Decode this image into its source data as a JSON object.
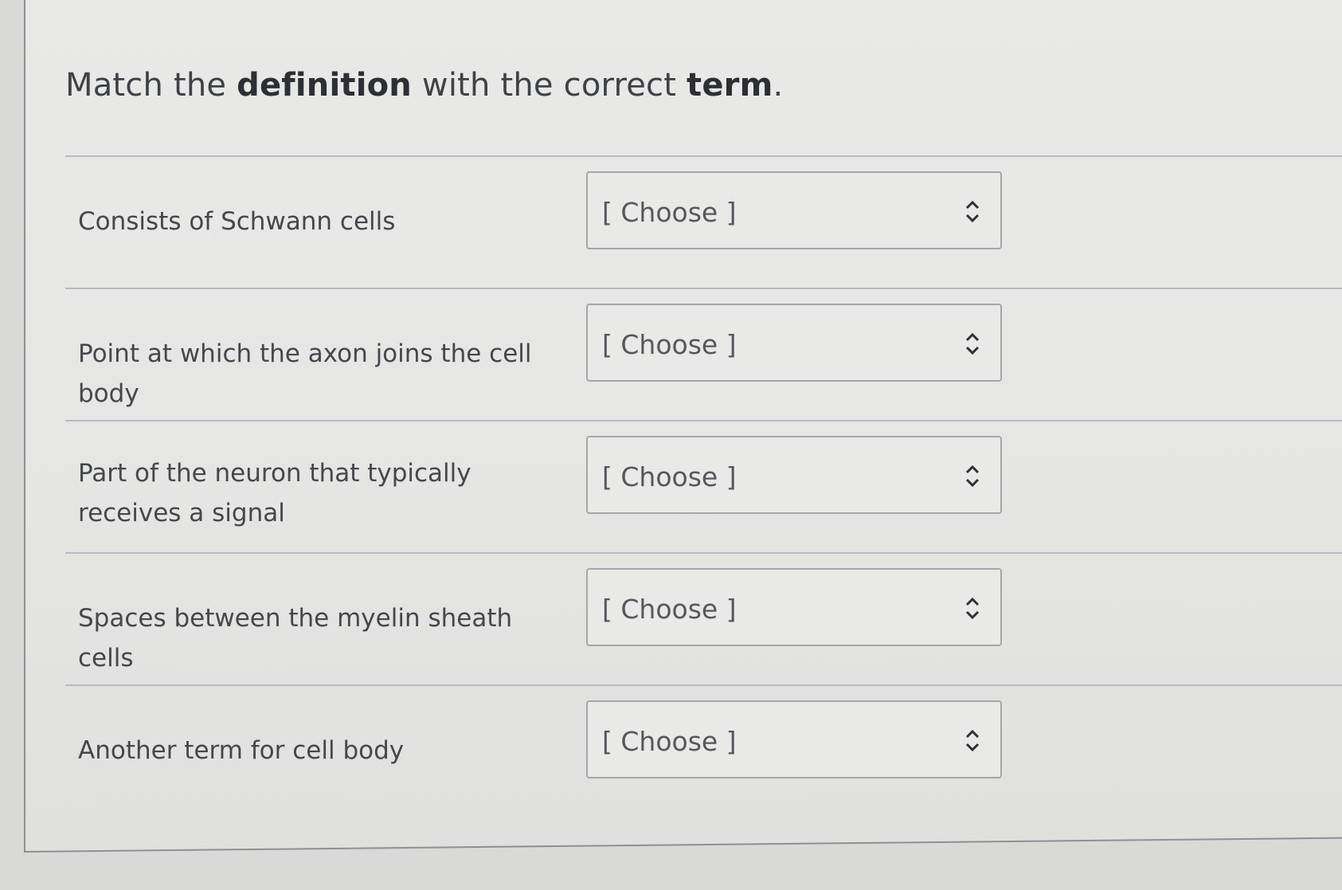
{
  "question": {
    "prefix": "Match the ",
    "bold1": "definition",
    "middle": " with the correct ",
    "bold2": "term",
    "suffix": "."
  },
  "rows": [
    {
      "definition": "Consists of Schwann cells",
      "selected": "[ Choose ]"
    },
    {
      "definition": "Point at which the axon joins the cell body",
      "selected": "[ Choose ]"
    },
    {
      "definition": "Part of the neuron that typically receives a signal",
      "selected": "[ Choose ]"
    },
    {
      "definition": "Spaces between the myelin sheath cells",
      "selected": "[ Choose ]"
    },
    {
      "definition": "Another term for cell body",
      "selected": "[ Choose ]"
    }
  ],
  "icons": {
    "select_arrow": "chevron-up-down-icon"
  }
}
